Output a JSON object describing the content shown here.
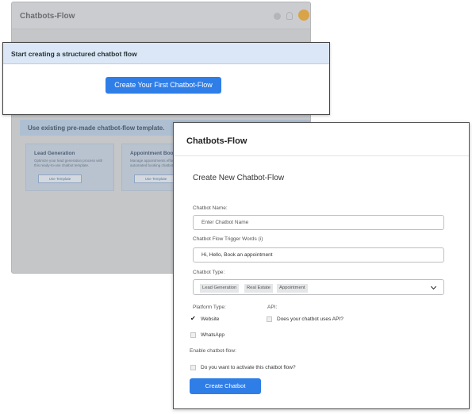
{
  "background_window": {
    "title": "Chatbots-Flow",
    "existing_template_heading": "Use existing pre-made chatbot-flow template.",
    "templates": [
      {
        "title": "Lead Generation",
        "description": "Optimize your lead generation process with this ready-to-use chatbot template.",
        "button": "Use Template"
      },
      {
        "title": "Appointment Booki",
        "description": "Manage appointments effortlessly with automated booking chatbot",
        "button": "Use Template"
      }
    ],
    "icons": [
      "gear-icon",
      "bell-icon",
      "avatar"
    ],
    "accent_color": "#d9a449"
  },
  "start_panel": {
    "heading": "Start creating a structured chatbot flow",
    "button_label": "Create Your First Chatbot-Flow"
  },
  "form": {
    "window_title": "Chatbots-Flow",
    "subtitle": "Create New Chatbot-Flow",
    "chatbot_name": {
      "label": "Chatbot Name:",
      "placeholder": "Enter Chatbot Name"
    },
    "trigger_words": {
      "label": "Chatbot Flow Trigger Words (i)",
      "value": "Hi, Hello, Book an appointment"
    },
    "chatbot_type": {
      "label": "Chatbot Type:",
      "selected": [
        "Lead Generation",
        "Real Estate",
        "Appointment"
      ]
    },
    "platform": {
      "label": "Platform Type:",
      "options": [
        {
          "label": "Website",
          "checked": true
        },
        {
          "label": "WhatsApp",
          "checked": false
        }
      ]
    },
    "api": {
      "label": "API:",
      "option": "Does your chatbot uses API?",
      "checked": false
    },
    "enable": {
      "label": "Enable chatbot-flow:",
      "option": "Do you want to activate this chatbot flow?",
      "checked": false
    },
    "submit_label": "Create Chatbot",
    "accent_color": "#2f7ee8"
  }
}
